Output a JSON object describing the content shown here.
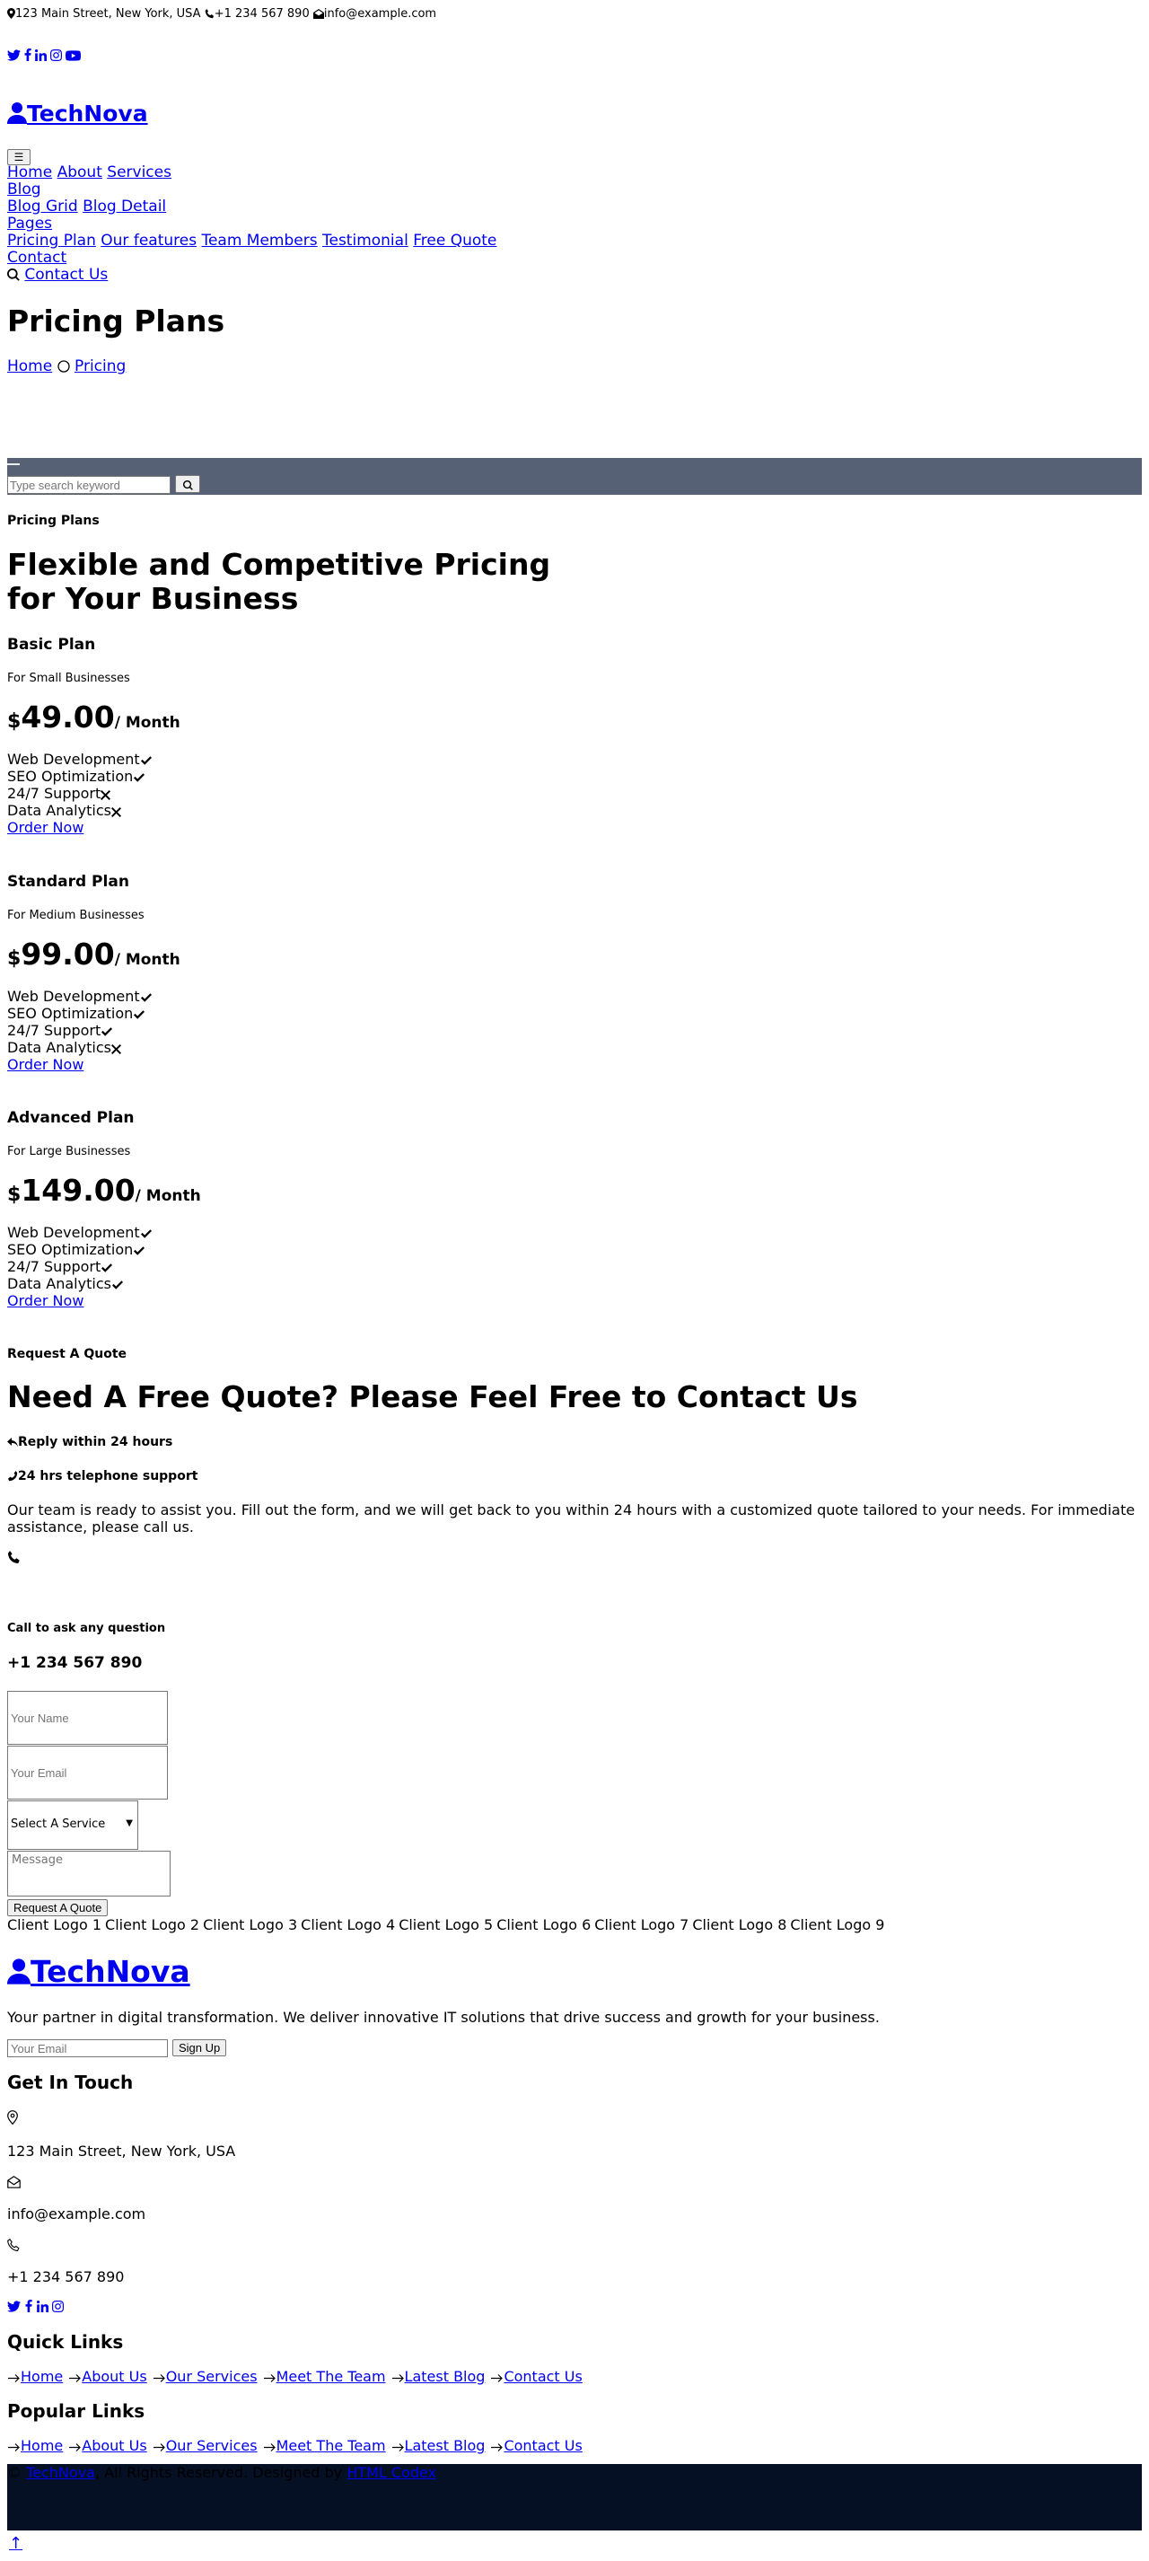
{
  "topbar": {
    "address": "123 Main Street, New York, USA",
    "phone": "+1 234 567 890",
    "email": "info@example.com"
  },
  "social_icons": [
    "twitter-icon",
    "facebook-icon",
    "linkedin-icon",
    "instagram-icon",
    "youtube-icon"
  ],
  "brand": {
    "name": "TechNova"
  },
  "nav": {
    "toggle_icon": "bars-icon",
    "home": "Home",
    "about": "About",
    "services": "Services",
    "blog": "Blog",
    "blog_grid": "Blog Grid",
    "blog_detail": "Blog Detail",
    "pages": "Pages",
    "pricing_plan": "Pricing Plan",
    "our_features": "Our features",
    "team_members": "Team Members",
    "testimonial": "Testimonial",
    "free_quote": "Free Quote",
    "contact": "Contact",
    "contact_us": "Contact Us"
  },
  "hero": {
    "title": "Pricing Plans",
    "breadcrumb_home": "Home",
    "breadcrumb_current": "Pricing"
  },
  "search": {
    "placeholder": "Type search keyword"
  },
  "pricing": {
    "subtitle": "Pricing Plans",
    "heading_line1": "Flexible and Competitive Pricing",
    "heading_line2": "for Your Business",
    "currency": "$",
    "period": "/ Month",
    "plans": [
      {
        "name": "Basic Plan",
        "for": "For Small Businesses",
        "price": "49.00",
        "features": [
          {
            "label": "Web Development",
            "included": true
          },
          {
            "label": "SEO Optimization",
            "included": true
          },
          {
            "label": "24/7 Support",
            "included": false
          },
          {
            "label": "Data Analytics",
            "included": false
          }
        ],
        "cta": "Order Now"
      },
      {
        "name": "Standard Plan",
        "for": "For Medium Businesses",
        "price": "99.00",
        "features": [
          {
            "label": "Web Development",
            "included": true
          },
          {
            "label": "SEO Optimization",
            "included": true
          },
          {
            "label": "24/7 Support",
            "included": true
          },
          {
            "label": "Data Analytics",
            "included": false
          }
        ],
        "cta": "Order Now"
      },
      {
        "name": "Advanced Plan",
        "for": "For Large Businesses",
        "price": "149.00",
        "features": [
          {
            "label": "Web Development",
            "included": true
          },
          {
            "label": "SEO Optimization",
            "included": true
          },
          {
            "label": "24/7 Support",
            "included": true
          },
          {
            "label": "Data Analytics",
            "included": true
          }
        ],
        "cta": "Order Now"
      }
    ]
  },
  "quote": {
    "subtitle": "Request A Quote",
    "heading": "Need A Free Quote? Please Feel Free to Contact Us",
    "reply": "Reply within 24 hours",
    "support": "24 hrs telephone support",
    "body": "Our team is ready to assist you. Fill out the form, and we will get back to you within 24 hours with a customized quote tailored to your needs. For immediate assistance, please call us.",
    "call_label": "Call to ask any question",
    "call_number": "+1 234 567 890",
    "name_placeholder": "Your Name",
    "email_placeholder": "Your Email",
    "service_selected": "Select A Service",
    "message_placeholder": "Message",
    "submit": "Request A Quote"
  },
  "clients": [
    "Client Logo 1",
    "Client Logo 2",
    "Client Logo 3",
    "Client Logo 4",
    "Client Logo 5",
    "Client Logo 6",
    "Client Logo 7",
    "Client Logo 8",
    "Client Logo 9"
  ],
  "footer": {
    "brand": "TechNova",
    "tagline": "Your partner in digital transformation. We deliver innovative IT solutions that drive success and growth for your business.",
    "newsletter_placeholder": "Your Email",
    "newsletter_button": "Sign Up",
    "get_in_touch": "Get In Touch",
    "address": "123 Main Street, New York, USA",
    "email": "info@example.com",
    "phone": "+1 234 567 890",
    "social_icons": [
      "twitter-icon",
      "facebook-icon",
      "linkedin-icon",
      "instagram-icon"
    ],
    "quick_links_title": "Quick Links",
    "quick_links": [
      "Home",
      "About Us",
      "Our Services",
      "Meet The Team",
      "Latest Blog",
      "Contact Us"
    ],
    "popular_links_title": "Popular Links",
    "popular_links": [
      "Home",
      "About Us",
      "Our Services",
      "Meet The Team",
      "Latest Blog",
      "Contact Us"
    ]
  },
  "copyright": {
    "symbol": "©",
    "brand": "TechNova",
    "text": ", All Rights Reserved. Designed by",
    "designer": "HTML Codex"
  },
  "back_to_top": "↑",
  "colors": {
    "link": "#0000ee",
    "search_band": "#566176",
    "footer_band": "#051024"
  }
}
